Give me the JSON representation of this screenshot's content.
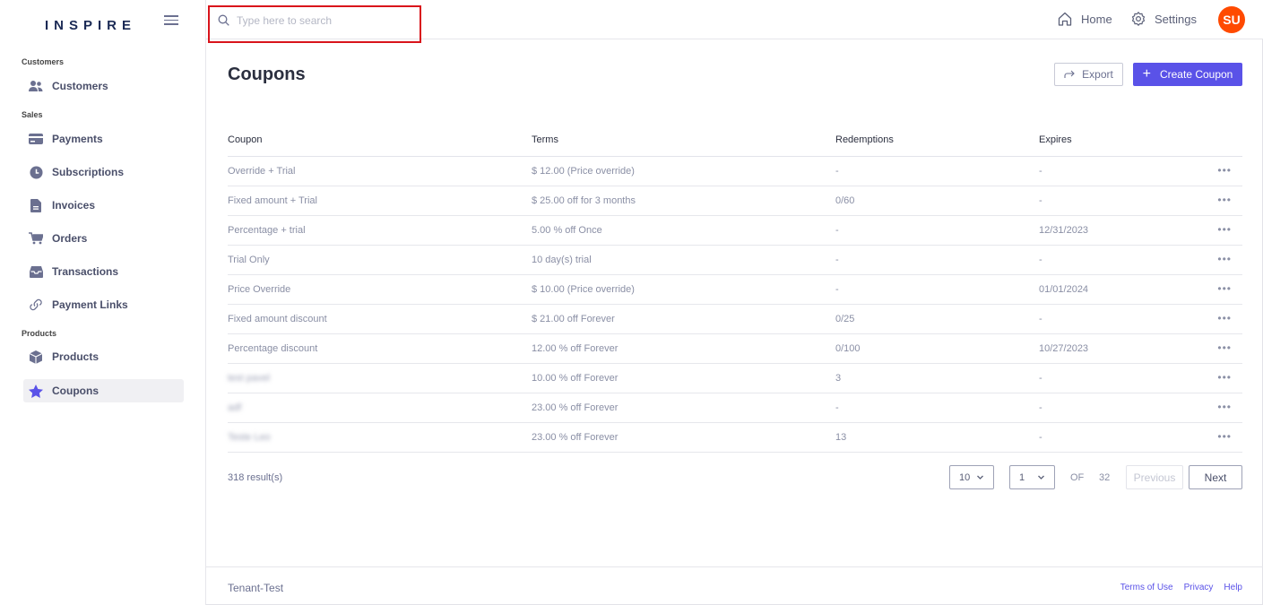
{
  "app": {
    "logo": "INSPIRE",
    "accent_color": "#5a52e8",
    "alert_color": "#d9141b",
    "avatar_color": "#ff4a00"
  },
  "sidebar": {
    "sections": [
      {
        "label": "Customers"
      },
      {
        "label": "Sales"
      },
      {
        "label": "Products"
      }
    ],
    "items": [
      {
        "label": "Customers",
        "icon": "users-icon"
      },
      {
        "label": "Payments",
        "icon": "credit-card-icon"
      },
      {
        "label": "Subscriptions",
        "icon": "clock-icon"
      },
      {
        "label": "Invoices",
        "icon": "document-icon"
      },
      {
        "label": "Orders",
        "icon": "cart-icon"
      },
      {
        "label": "Transactions",
        "icon": "inbox-icon"
      },
      {
        "label": "Payment Links",
        "icon": "link-icon"
      },
      {
        "label": "Products",
        "icon": "box-icon"
      },
      {
        "label": "Coupons",
        "icon": "star-icon",
        "active": true
      }
    ]
  },
  "topbar": {
    "search_placeholder": "Type here to search",
    "search_value": "",
    "home_label": "Home",
    "settings_label": "Settings",
    "avatar_initials": "SU"
  },
  "main": {
    "title": "Coupons",
    "export_label": "Export",
    "create_label": "Create Coupon",
    "columns": [
      "Coupon",
      "Terms",
      "Redemptions",
      "Expires"
    ],
    "rows": [
      {
        "coupon": "Override + Trial",
        "terms": "$ 12.00 (Price override)",
        "redemptions": "-",
        "expires": "-"
      },
      {
        "coupon": "Fixed amount + Trial",
        "terms": "$ 25.00 off for 3 months",
        "redemptions": "0/60",
        "expires": "-"
      },
      {
        "coupon": "Percentage + trial",
        "terms": "5.00 % off Once",
        "redemptions": "-",
        "expires": "12/31/2023"
      },
      {
        "coupon": "Trial Only",
        "terms": "10 day(s) trial",
        "redemptions": "-",
        "expires": "-"
      },
      {
        "coupon": "Price Override",
        "terms": "$ 10.00 (Price override)",
        "redemptions": "-",
        "expires": "01/01/2024"
      },
      {
        "coupon": "Fixed amount discount",
        "terms": "$ 21.00 off Forever",
        "redemptions": "0/25",
        "expires": "-"
      },
      {
        "coupon": "Percentage discount",
        "terms": "12.00 % off Forever",
        "redemptions": "0/100",
        "expires": "10/27/2023"
      },
      {
        "coupon": "test pavel",
        "terms": "10.00 % off Forever",
        "redemptions": "3",
        "expires": "-",
        "blurred": true
      },
      {
        "coupon": "adf",
        "terms": "23.00 % off Forever",
        "redemptions": "-",
        "expires": "-",
        "blurred": true
      },
      {
        "coupon": "Teste Leo",
        "terms": "23.00 % off Forever",
        "redemptions": "13",
        "expires": "-",
        "blurred": true
      }
    ],
    "results_text": "318 result(s)",
    "page_size": "10",
    "current_page": "1",
    "of_label": "OF",
    "total_pages": "32",
    "prev_label": "Previous",
    "next_label": "Next"
  },
  "footer": {
    "tenant": "Tenant-Test",
    "terms_label": "Terms of Use",
    "privacy_label": "Privacy",
    "help_label": "Help"
  }
}
